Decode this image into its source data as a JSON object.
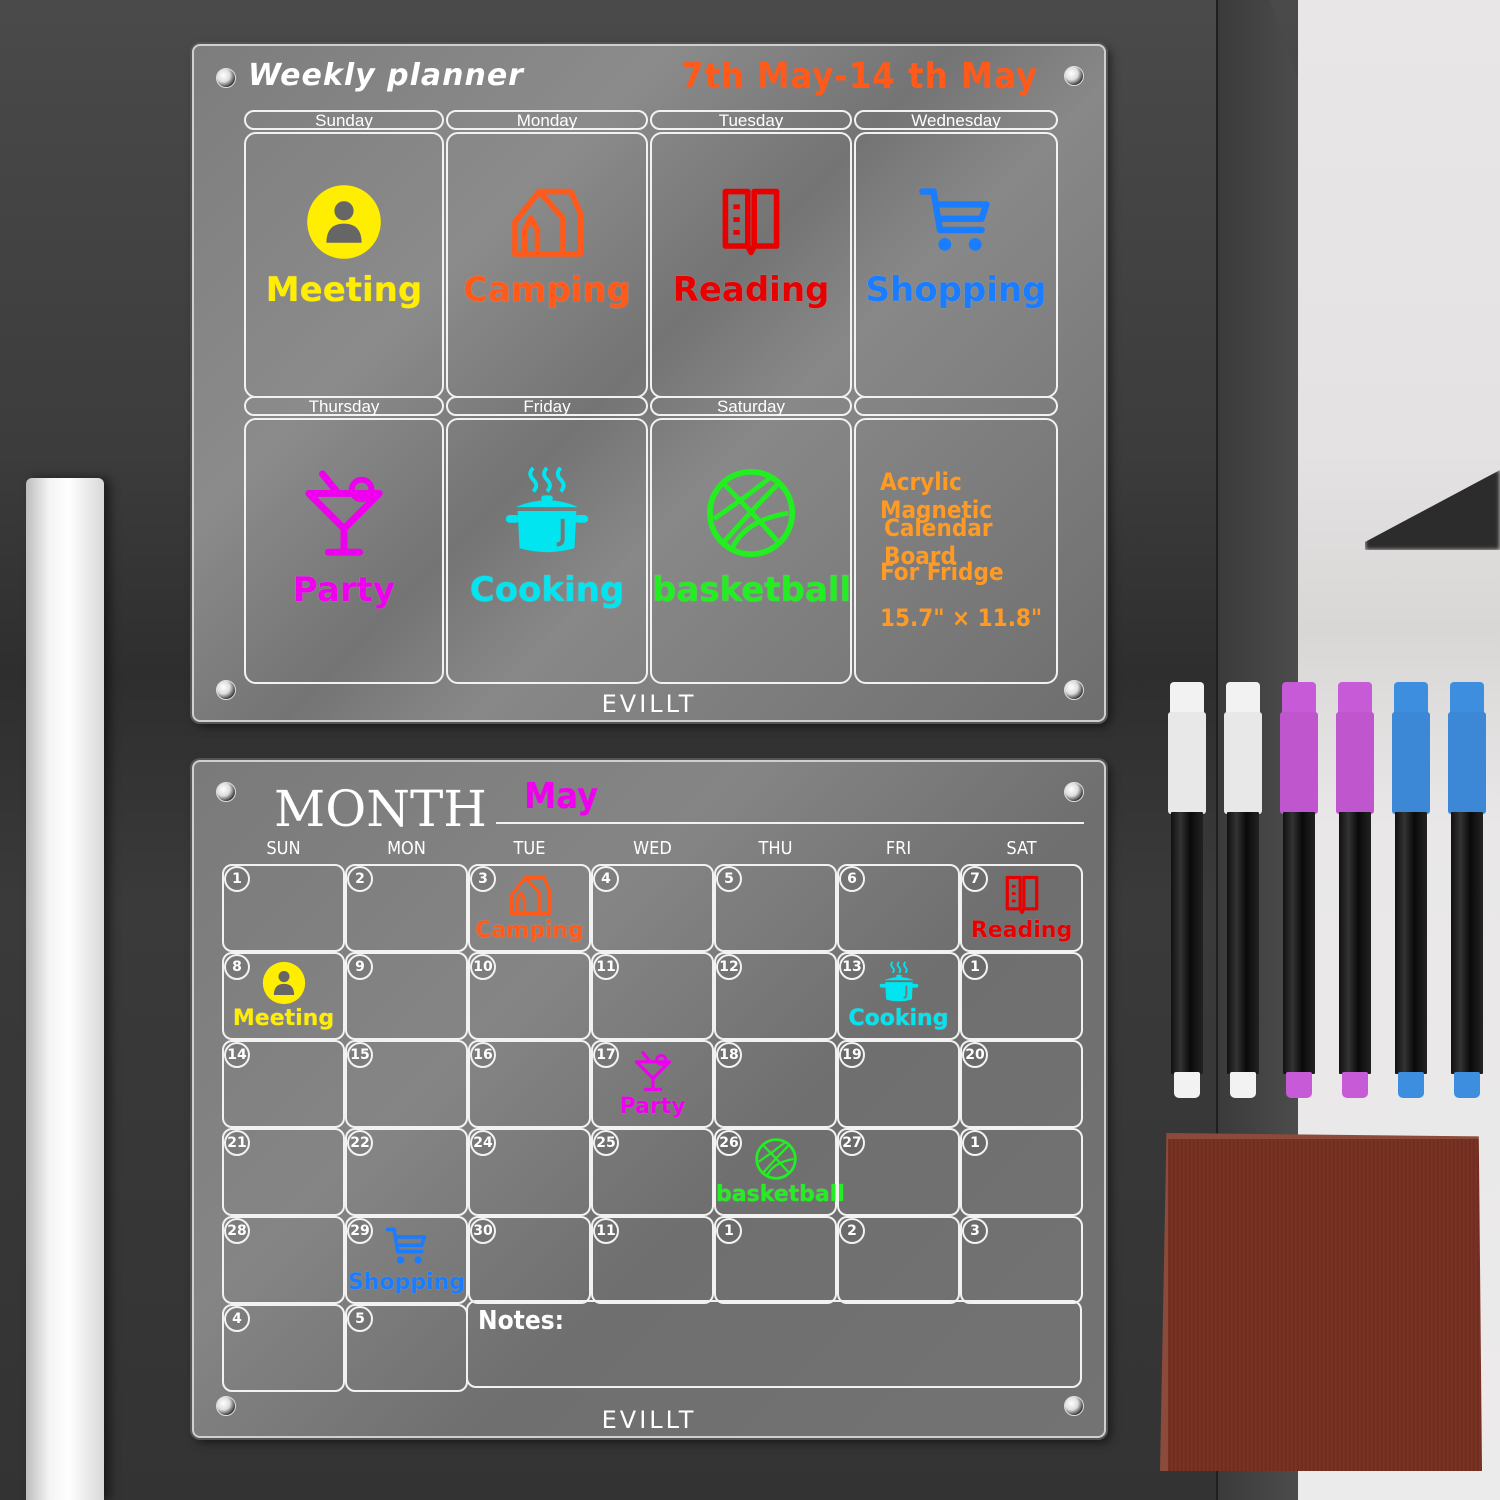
{
  "weekly_planner": {
    "title": "Weekly planner",
    "date_range": "7th May-14 th May",
    "brand": "EVILLT",
    "days": [
      {
        "name": "Sunday",
        "event": "Meeting",
        "icon": "person-circle-icon",
        "color": "#ffee00"
      },
      {
        "name": "Monday",
        "event": "Camping",
        "icon": "tent-icon",
        "color": "#ff5a1a"
      },
      {
        "name": "Tuesday",
        "event": "Reading",
        "icon": "book-icon",
        "color": "#e80000"
      },
      {
        "name": "Wednesday",
        "event": "Shopping",
        "icon": "shopping-cart-icon",
        "color": "#1a7cff"
      },
      {
        "name": "Thursday",
        "event": "Party",
        "icon": "cocktail-icon",
        "color": "#ee00ee"
      },
      {
        "name": "Friday",
        "event": "Cooking",
        "icon": "cooking-pot-icon",
        "color": "#00e5f0"
      },
      {
        "name": "Saturday",
        "event": "basketball",
        "icon": "basketball-icon",
        "color": "#22ee22"
      }
    ],
    "info": {
      "lines": [
        "Acrylic Magnetic",
        "Calendar Board",
        "For Fridge",
        "15.7\" × 11.8\""
      ],
      "color": "#ff9a24"
    }
  },
  "monthly_calendar": {
    "title": "MONTH",
    "month": "May",
    "brand": "EVILLT",
    "weekdays": [
      "SUN",
      "MON",
      "TUE",
      "WED",
      "THU",
      "FRI",
      "SAT"
    ],
    "weeks": [
      [
        "1",
        "2",
        "3",
        "4",
        "5",
        "6",
        "7"
      ],
      [
        "8",
        "9",
        "10",
        "11",
        "12",
        "13",
        "1"
      ],
      [
        "14",
        "15",
        "16",
        "17",
        "18",
        "19",
        "20"
      ],
      [
        "21",
        "22",
        "24",
        "25",
        "26",
        "27",
        "1"
      ],
      [
        "28",
        "29",
        "30",
        "11",
        "1",
        "2",
        "3"
      ],
      [
        "4",
        "5"
      ]
    ],
    "events": [
      {
        "week": 0,
        "day": 2,
        "label": "Camping",
        "icon": "tent-icon",
        "color": "#ff5a1a"
      },
      {
        "week": 0,
        "day": 6,
        "label": "Reading",
        "icon": "book-icon",
        "color": "#e80000"
      },
      {
        "week": 1,
        "day": 0,
        "label": "Meeting",
        "icon": "person-circle-icon",
        "color": "#ffee00"
      },
      {
        "week": 1,
        "day": 5,
        "label": "Cooking",
        "icon": "cooking-pot-icon",
        "color": "#00e5f0"
      },
      {
        "week": 2,
        "day": 3,
        "label": "Party",
        "icon": "cocktail-icon",
        "color": "#ee00ee"
      },
      {
        "week": 3,
        "day": 4,
        "label": "basketball",
        "icon": "basketball-icon",
        "color": "#22ee22"
      },
      {
        "week": 4,
        "day": 1,
        "label": "Shopping",
        "icon": "shopping-cart-icon",
        "color": "#1a7cff"
      }
    ],
    "notes_label": "Notes:"
  },
  "markers": [
    {
      "color": "white",
      "cap": "#f2f2f2"
    },
    {
      "color": "white",
      "cap": "#f2f2f2"
    },
    {
      "color": "purple",
      "cap": "#c75ad6"
    },
    {
      "color": "purple",
      "cap": "#c75ad6"
    },
    {
      "color": "blue",
      "cap": "#3e8ee0"
    },
    {
      "color": "blue",
      "cap": "#3e8ee0"
    }
  ],
  "cloth": {
    "color": "#7a3324",
    "label": "microfiber cleaning cloth"
  }
}
